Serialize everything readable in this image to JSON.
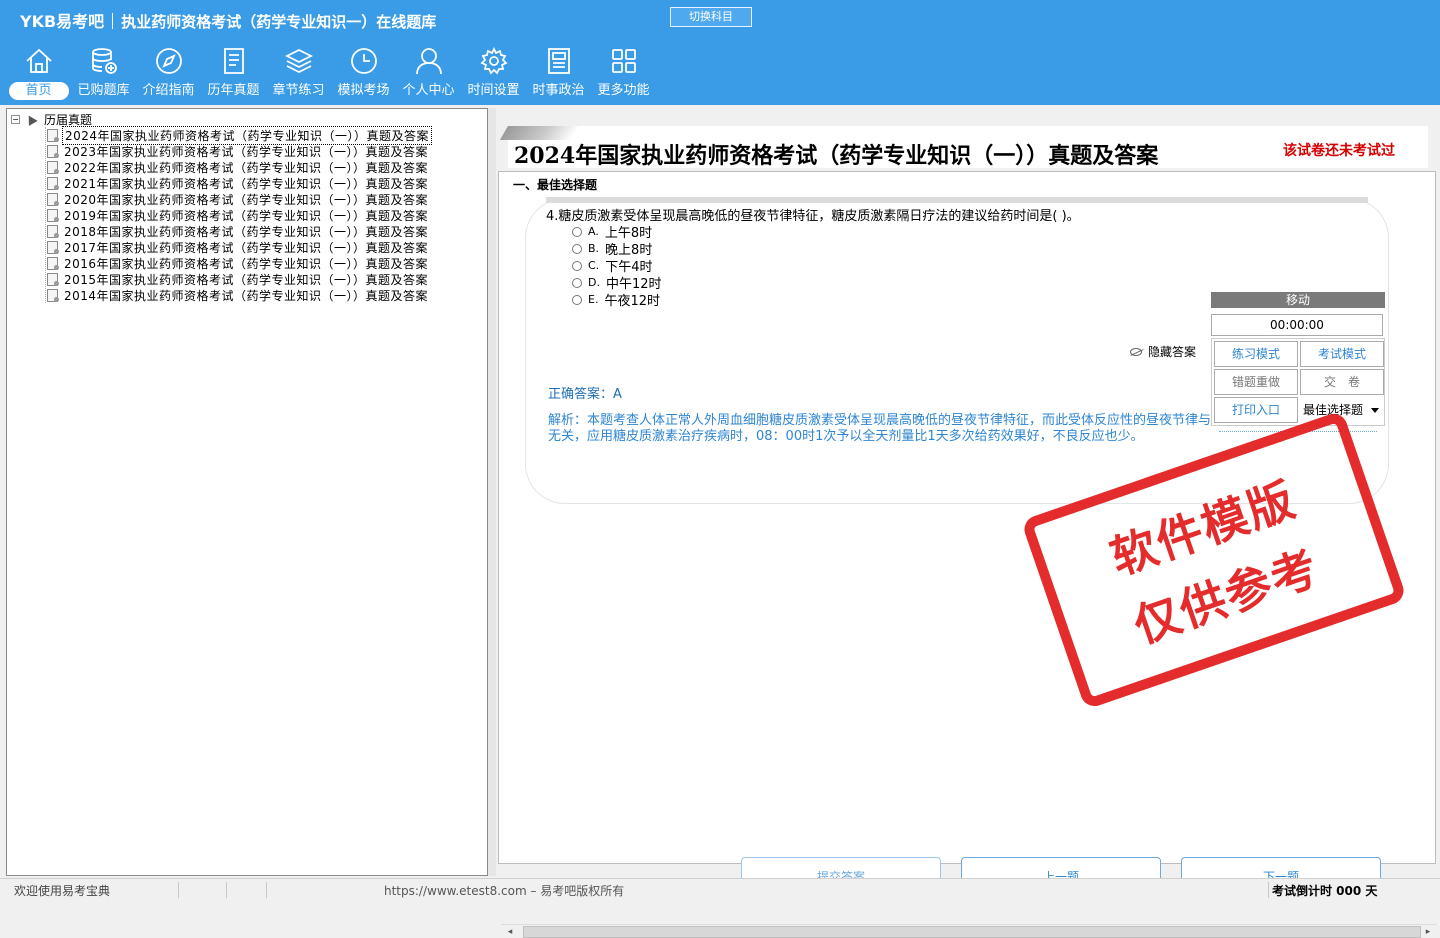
{
  "header": {
    "brand": "YKB易考吧",
    "title": "执业药师资格考试（药学专业知识一）在线题库",
    "switch_subject": "切换科目"
  },
  "nav": [
    {
      "label": "首页",
      "icon": "home-icon",
      "active": true
    },
    {
      "label": "已购题库",
      "icon": "database-icon"
    },
    {
      "label": "介绍指南",
      "icon": "compass-icon"
    },
    {
      "label": "历年真题",
      "icon": "document-list-icon"
    },
    {
      "label": "章节练习",
      "icon": "layers-icon"
    },
    {
      "label": "模拟考场",
      "icon": "clock-icon"
    },
    {
      "label": "个人中心",
      "icon": "user-icon"
    },
    {
      "label": "时间设置",
      "icon": "gear-icon"
    },
    {
      "label": "时事政治",
      "icon": "newspaper-icon"
    },
    {
      "label": "更多功能",
      "icon": "grid-icon"
    }
  ],
  "tree": {
    "root": "历届真题",
    "items": [
      "2024年国家执业药师资格考试（药学专业知识（一））真题及答案",
      "2023年国家执业药师资格考试（药学专业知识（一））真题及答案",
      "2022年国家执业药师资格考试（药学专业知识（一））真题及答案",
      "2021年国家执业药师资格考试（药学专业知识（一））真题及答案",
      "2020年国家执业药师资格考试（药学专业知识（一））真题及答案",
      "2019年国家执业药师资格考试（药学专业知识（一））真题及答案",
      "2018年国家执业药师资格考试（药学专业知识（一））真题及答案",
      "2017年国家执业药师资格考试（药学专业知识（一））真题及答案",
      "2016年国家执业药师资格考试（药学专业知识（一））真题及答案",
      "2015年国家执业药师资格考试（药学专业知识（一））真题及答案",
      "2014年国家执业药师资格考试（药学专业知识（一））真题及答案"
    ]
  },
  "exam": {
    "title": "2024年国家执业药师资格考试（药学专业知识（一））真题及答案",
    "status": "该试卷还未考试过",
    "section": "一、最佳选择题"
  },
  "question": {
    "text": "4.糖皮质激素受体呈现晨高晚低的昼夜节律特征，糖皮质激素隔日疗法的建议给药时间是( )。",
    "options": [
      {
        "key": "A.",
        "text": "上午8时"
      },
      {
        "key": "B.",
        "text": "晚上8时"
      },
      {
        "key": "C.",
        "text": "下午4时"
      },
      {
        "key": "D.",
        "text": "中午12时"
      },
      {
        "key": "E.",
        "text": "午夜12时"
      }
    ],
    "hide_answer": "隐藏答案",
    "correct_answer": "正确答案：A",
    "analysis": "解析：本题考查人体正常人外周血细胞糖皮质激素受体呈现晨高晚低的昼夜节律特征，而此受体反应性的昼夜节律与血中的糖皮质激素浓度无关，应用糖皮质激素治疗疾病时，08：00时1次予以全天剂量比1天多次给药效果好，不良反应也少。"
  },
  "timer_widget": {
    "move": "移动",
    "time": "00:00:00",
    "buttons": [
      "练习模式",
      "考试模式",
      "错题重做",
      "交　卷",
      "打印入口"
    ],
    "select_value": "最佳选择题"
  },
  "stamp": {
    "line1": "软件模版",
    "line2": "仅供参考"
  },
  "bottom_buttons": {
    "submit": "提交答案",
    "prev": "上一题",
    "next": "下一题"
  },
  "statusbar": {
    "welcome": "欢迎使用易考宝典",
    "url": "https://www.etest8.com – 易考吧版权所有",
    "countdown": "考试倒计时 000 天"
  }
}
